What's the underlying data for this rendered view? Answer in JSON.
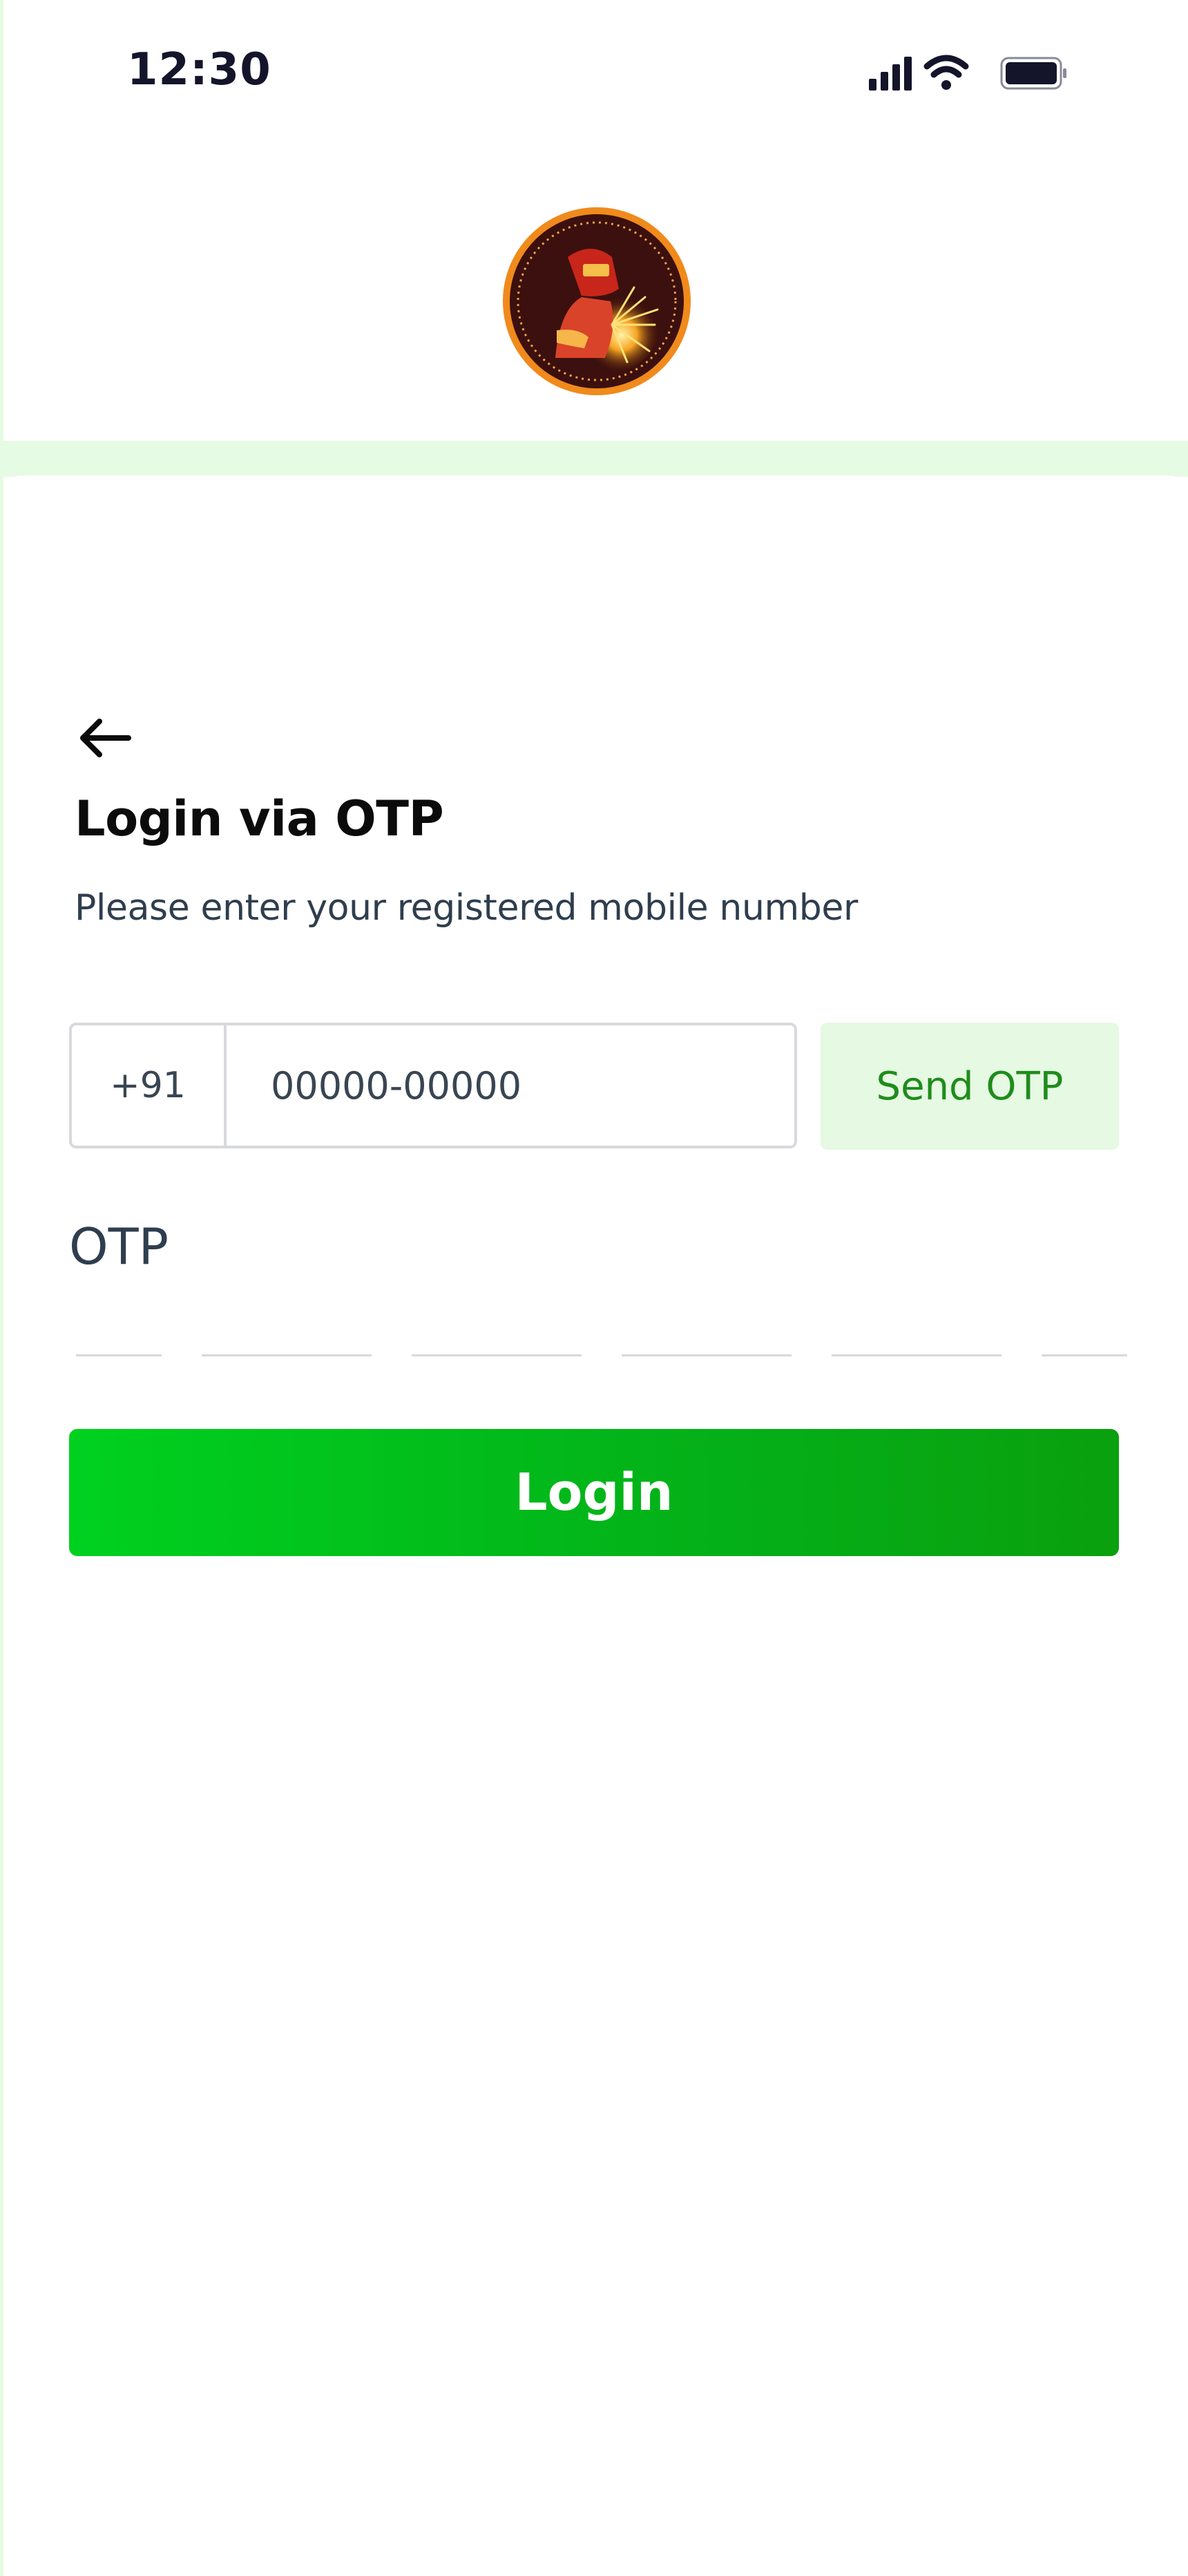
{
  "status_bar": {
    "time": "12:30",
    "icons": [
      "signal-icon",
      "wifi-icon",
      "battery-icon"
    ]
  },
  "logo": {
    "icon": "welder-logo"
  },
  "login": {
    "back_icon": "arrow-left-icon",
    "title": "Login via OTP",
    "subtitle": "Please enter your registered mobile number",
    "country_code": "+91",
    "phone_placeholder": "00000-00000",
    "phone_value": "",
    "send_otp_label": "Send OTP",
    "otp_label": "OTP",
    "otp_digits": [
      "",
      "",
      "",
      "",
      "",
      ""
    ],
    "login_label": "Login"
  },
  "colors": {
    "accent_green": "#03b319",
    "send_otp_bg": "#e6f9e3",
    "send_otp_text": "#1f8c1b",
    "band": "#e6fbe3"
  }
}
